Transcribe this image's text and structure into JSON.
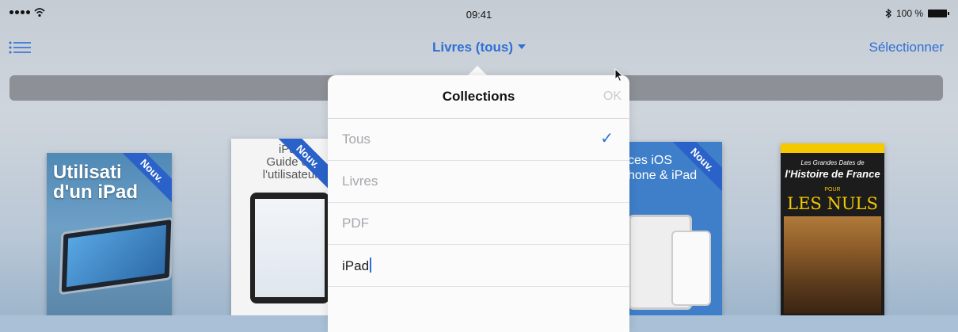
{
  "status_bar": {
    "time": "09:41",
    "battery": "100 %"
  },
  "nav": {
    "title": "Livres (tous)",
    "select_label": "Sélectionner"
  },
  "books": [
    {
      "title_line1": "Utilisati",
      "title_line2": "d'un iPad",
      "badge": "Nouv."
    },
    {
      "title_line1": "iPad",
      "title_line2": "Guide de",
      "title_line3": "l'utilisateur",
      "badge": "Nouv."
    },
    {
      "title_line1": "ces iOS",
      "title_line2": "hone & iPad",
      "badge": "Nouv."
    },
    {
      "subtitle": "Les Grandes Dates de",
      "title": "l'Histoire de France",
      "pour": "POUR",
      "series": "LES NULS"
    }
  ],
  "popover": {
    "title": "Collections",
    "ok_label": "OK",
    "items": [
      {
        "label": "Tous",
        "checked": true
      },
      {
        "label": "Livres",
        "checked": false
      },
      {
        "label": "PDF",
        "checked": false
      },
      {
        "label": "iPad",
        "editing": true
      }
    ]
  },
  "colors": {
    "accent": "#2f6fd6",
    "searchbar": "#8d9096"
  }
}
